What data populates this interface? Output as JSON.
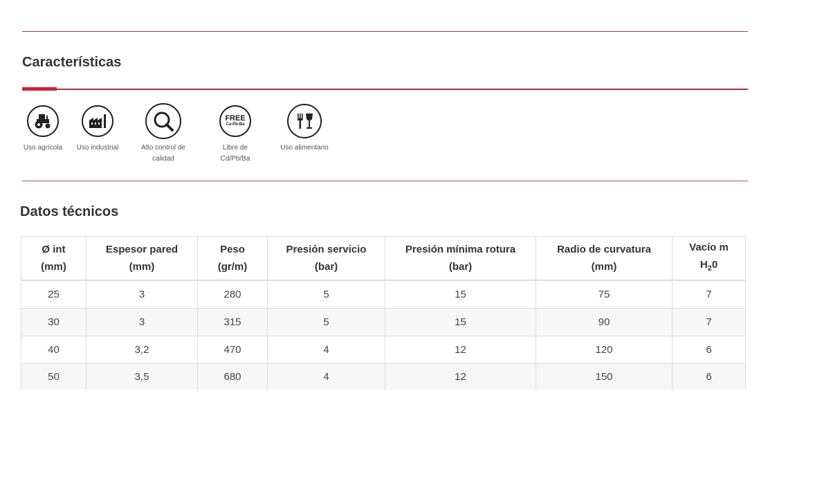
{
  "features_title": "Características",
  "data_title": "Datos técnicos",
  "features": [
    {
      "icon": "tractor-icon",
      "label": "Uso agrícola"
    },
    {
      "icon": "factory-icon",
      "label": "Uso industrial"
    },
    {
      "icon": "magnifier-icon",
      "label": "Alto control de calidad"
    },
    {
      "icon": "free-badge-icon",
      "label": "Libre de Cd/Pb/Ba",
      "badge_text": "FREE",
      "badge_sub": "Ca-Pb-Ba"
    },
    {
      "icon": "cutlery-glass-icon",
      "label": "Uso alimentario"
    }
  ],
  "table": {
    "headers": [
      {
        "line1": "Ø int",
        "line2": "(mm)"
      },
      {
        "line1": "Espesor pared",
        "line2": "(mm)"
      },
      {
        "line1": "Peso",
        "line2": "(gr/m)"
      },
      {
        "line1": "Presión servicio",
        "line2": "(bar)"
      },
      {
        "line1": "Presión mínima rotura",
        "line2": "(bar)"
      },
      {
        "line1": "Radio de curvatura",
        "line2": "(mm)"
      },
      {
        "line1": "Vacío m",
        "line2": "H",
        "line2_sub": "2",
        "line2_tail": "0"
      }
    ],
    "rows": [
      [
        "25",
        "3",
        "280",
        "5",
        "15",
        "75",
        "7"
      ],
      [
        "30",
        "3",
        "315",
        "5",
        "15",
        "90",
        "7"
      ],
      [
        "40",
        "3,2",
        "470",
        "4",
        "12",
        "120",
        "6"
      ],
      [
        "50",
        "3,5",
        "680",
        "4",
        "12",
        "150",
        "6"
      ]
    ]
  },
  "colors": {
    "accent": "#d21f3a",
    "rule": "#9b3a48"
  }
}
